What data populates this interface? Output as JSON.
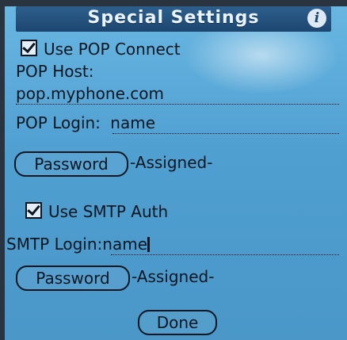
{
  "title": "Special Settings",
  "pop": {
    "connect_checked": true,
    "connect_label": "Use POP Connect",
    "host_label": "POP Host:",
    "host_value": "pop.myphone.com",
    "login_label": "POP Login:",
    "login_value": "name",
    "password_button": "Password",
    "password_status": "-Assigned-"
  },
  "smtp": {
    "auth_checked": true,
    "auth_label": "Use SMTP Auth",
    "login_label": "SMTP Login:",
    "login_value": "name",
    "password_button": "Password",
    "password_status": "-Assigned-"
  },
  "done_button": "Done",
  "icons": {
    "info": "info-icon",
    "checkbox": "checkmark-icon"
  }
}
